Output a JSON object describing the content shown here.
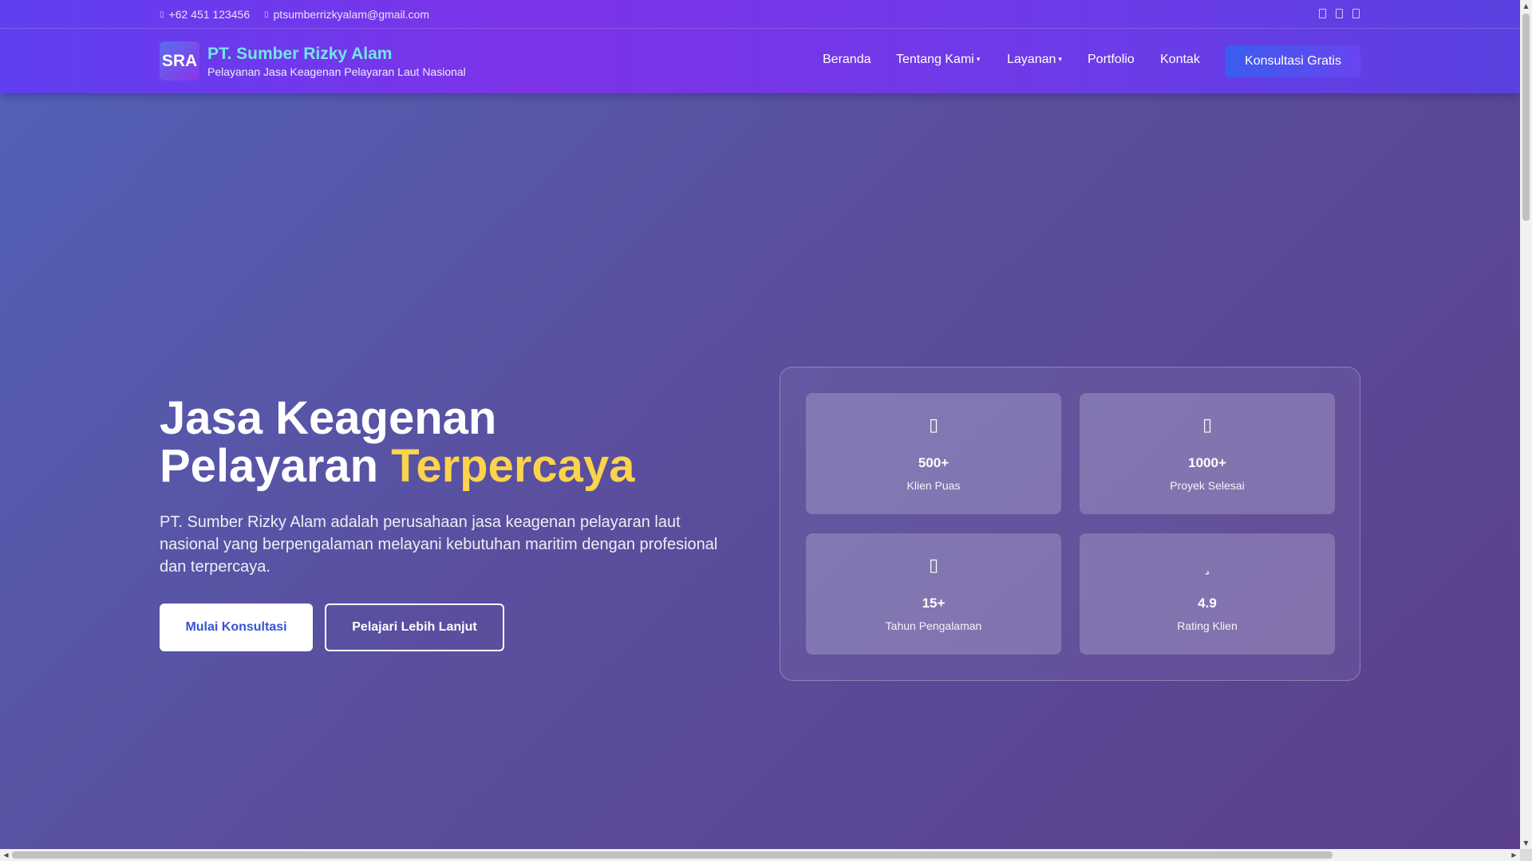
{
  "topbar": {
    "phone": "+62 451 123456",
    "phone_icon": "phone-icon",
    "email": "ptsumberrizkyalam@gmail.com",
    "email_icon": "envelope-icon",
    "socials": [
      "facebook-icon",
      "instagram-icon",
      "linkedin-icon"
    ]
  },
  "brand": {
    "logo_text": "SRA",
    "name": "PT. Sumber Rizky Alam",
    "tagline": "Pelayanan Jasa Keagenan Pelayaran Laut Nasional",
    "name_color": "#73e5e8"
  },
  "nav": {
    "items": [
      {
        "label": "Beranda",
        "has_dropdown": false
      },
      {
        "label": "Tentang Kami",
        "has_dropdown": true
      },
      {
        "label": "Layanan",
        "has_dropdown": true
      },
      {
        "label": "Portfolio",
        "has_dropdown": false
      },
      {
        "label": "Kontak",
        "has_dropdown": false
      }
    ],
    "caret": "▾",
    "cta_label": "Konsultasi Gratis"
  },
  "hero": {
    "title_line1": "Jasa Keagenan",
    "title_line2": "Pelayaran",
    "title_highlight": "Terpercaya",
    "highlight_color": "#fcd34d",
    "description": "PT. Sumber Rizky Alam adalah perusahaan jasa keagenan pelayaran laut nasional yang berpengalaman melayani kebutuhan maritim dengan profesional dan terpercaya.",
    "primary_button": "Mulai Konsultasi",
    "secondary_button": "Pelajari Lebih Lanjut"
  },
  "stats": [
    {
      "icon": "users-icon",
      "value": "500+",
      "label": "Klien Puas"
    },
    {
      "icon": "briefcase-icon",
      "value": "1000+",
      "label": "Proyek Selesai"
    },
    {
      "icon": "calendar-icon",
      "value": "15+",
      "label": "Tahun Pengalaman"
    },
    {
      "icon": "star-icon",
      "value": "4.9",
      "label": "Rating Klien"
    }
  ],
  "colors": {
    "header_gradient_start": "#5f3ff0",
    "header_gradient_mid": "#7d33e8",
    "cta_gradient_start": "#3a5df0",
    "primary_button_text": "#3654d4"
  }
}
